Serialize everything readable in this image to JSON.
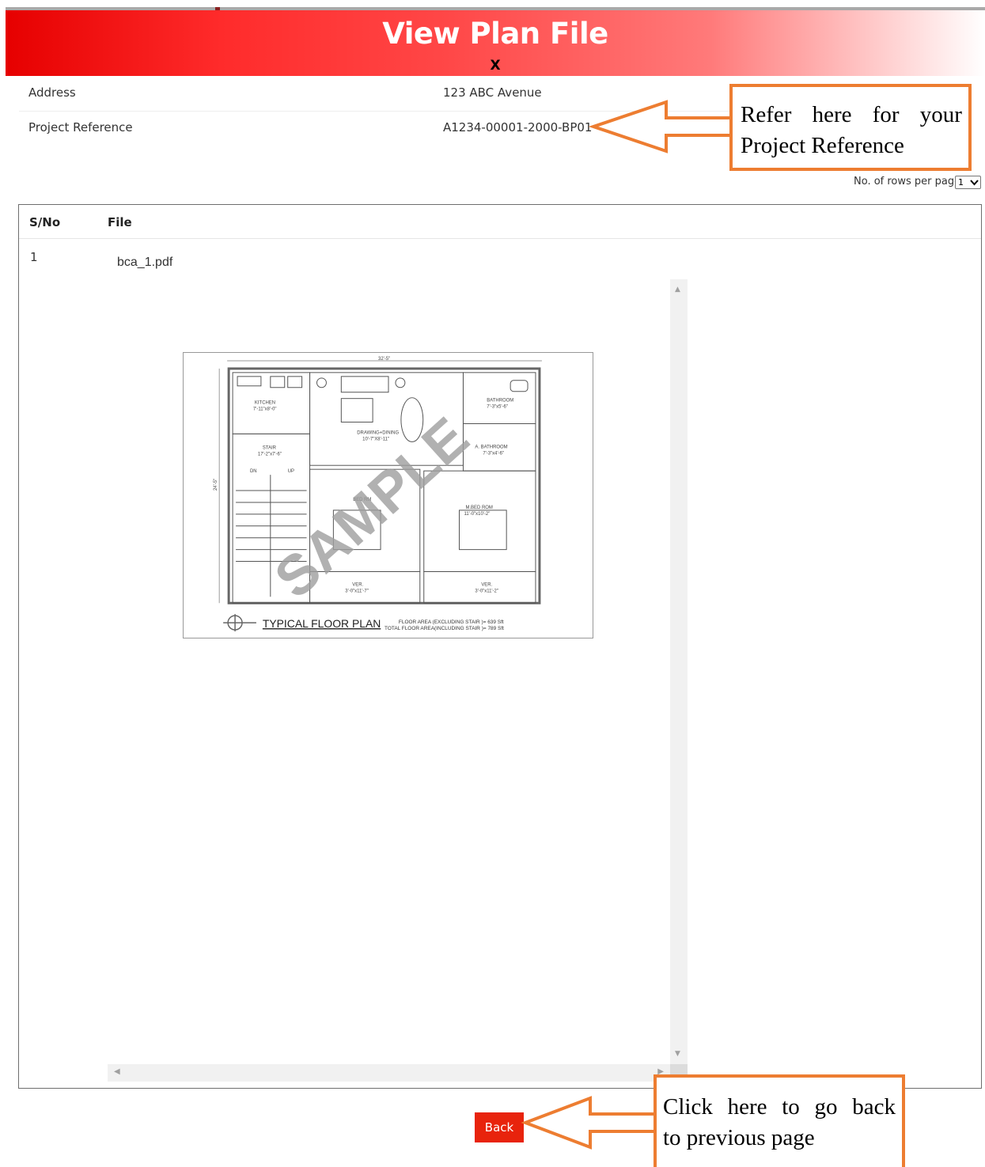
{
  "header": {
    "title": "View Plan File",
    "close_label": "X"
  },
  "info": {
    "address_label": "Address",
    "address_value": "123 ABC Avenue",
    "project_ref_label": "Project Reference",
    "project_ref_value": "A1234-00001-2000-BP01"
  },
  "callouts": {
    "ref_words": [
      "Refer",
      "here",
      "for",
      "your"
    ],
    "ref_line2": "Project Reference",
    "back_words": [
      "Click",
      "here",
      "to",
      "go",
      "back"
    ],
    "back_line2": "to previous page",
    "color": "#ed7d31"
  },
  "pagination": {
    "rows_label": "No. of rows per page",
    "rows_value": "1"
  },
  "table": {
    "headers": [
      "S/No",
      "File"
    ],
    "rows": [
      {
        "sno": "1",
        "file": "bca_1.pdf"
      }
    ]
  },
  "plan_image": {
    "watermark": "SAMPLE",
    "plan_title": "TYPICAL FLOOR PLAN",
    "area_line1": "FLOOR AREA (EXCLUDING STAIR )= 639 Sft",
    "area_line2": "TOTAL FLOOR AREA(INCLUDING STAIR )= 789 Sft",
    "dim_top": "32'-5\"",
    "dim_side": "24'-5\"",
    "rooms": {
      "kitchen": "KITCHEN",
      "kitchen_size": "7'-11\"x8'-0\"",
      "drawing": "DRAWING+DINING",
      "drawing_size": "10'-7\"X8'-11\"",
      "bathroom": "BATHROOM",
      "bathroom_size": "7'-3\"x5'-6\"",
      "stair": "STAIR",
      "stair_size": "17'-2\"x7'-6\"",
      "dn": "DN",
      "up": "UP",
      "bed2": "BED RM",
      "m_bed": "M.BED ROM",
      "m_bed_size": "11'-0\"x10'-2\"",
      "a_bath": "A. BATHROOM",
      "a_bath_size": "7'-3\"x4'-6\"",
      "ver1": "VER.",
      "ver1_size": "3'-0\"x11'-7\"",
      "ver2": "VER.",
      "ver2_size": "3'-0\"x11'-2\""
    }
  },
  "back_button_label": "Back",
  "colors": {
    "header_red": "#e60000",
    "back_red": "#e8230c",
    "callout_orange": "#ed7d31"
  }
}
